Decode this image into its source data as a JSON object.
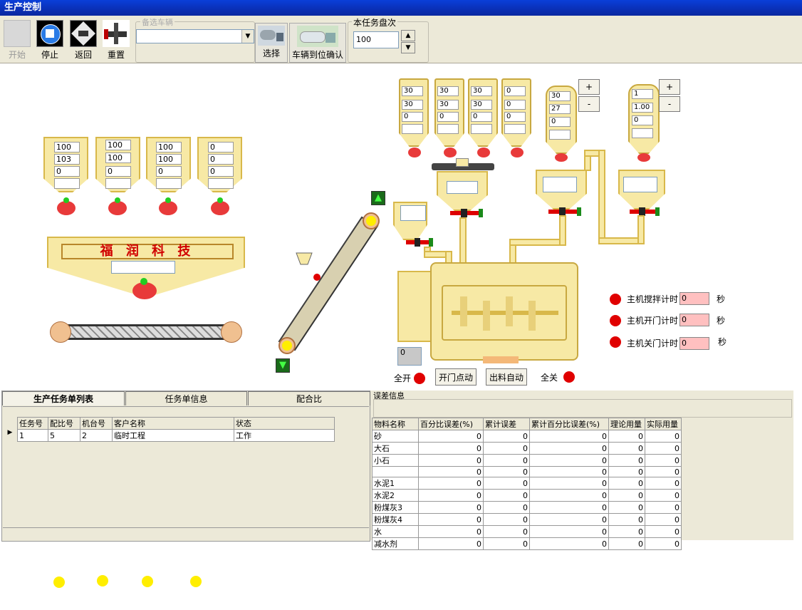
{
  "window": {
    "title": "生产控制"
  },
  "toolbar": {
    "start_label": "开始",
    "stop_label": "停止",
    "back_label": "返回",
    "reset_label": "重置",
    "vehicle_group_label": "备选车辆",
    "vehicle_value": "",
    "select_label": "选择",
    "confirm_label": "车辆到位确认",
    "batches_group_label": "本任务盘次",
    "batches_value": "100"
  },
  "aggregate_bins": [
    {
      "values": [
        "100",
        "103",
        "0",
        ""
      ]
    },
    {
      "values": [
        "100",
        "100",
        "0",
        ""
      ]
    },
    {
      "values": [
        "100",
        "100",
        "0",
        ""
      ]
    },
    {
      "values": [
        "0",
        "0",
        "0",
        ""
      ]
    }
  ],
  "brand_text": "福 润 科 技",
  "weigh_hopper_value": "",
  "powder_silos": [
    {
      "values": [
        "30",
        "30",
        "0",
        ""
      ]
    },
    {
      "values": [
        "30",
        "30",
        "0",
        ""
      ]
    },
    {
      "values": [
        "30",
        "30",
        "0",
        ""
      ]
    },
    {
      "values": [
        "0",
        "0",
        "0",
        ""
      ]
    }
  ],
  "water_tank": {
    "values": [
      "30",
      "27",
      "0",
      ""
    ]
  },
  "additive_tank": {
    "values": [
      "1",
      "1.00",
      "0",
      ""
    ]
  },
  "plus_label": "+",
  "minus_label": "-",
  "timers": [
    {
      "label": "主机搅拌计时",
      "value": "0",
      "unit": "秒"
    },
    {
      "label": "主机开门计时",
      "value": "0",
      "unit": "秒"
    },
    {
      "label": "主机关门计时",
      "value": "0",
      "unit": "秒"
    }
  ],
  "mixer": {
    "counter_value": "0"
  },
  "door_controls": {
    "all_open": "全开",
    "door_jog": "开门点动",
    "discharge_auto": "出料自动",
    "all_close": "全关"
  },
  "tabs": [
    "生产任务单列表",
    "任务单信息",
    "配合比"
  ],
  "task_table": {
    "columns": [
      "任务号",
      "配比号",
      "机台号",
      "客户名称",
      "状态"
    ],
    "rows": [
      [
        "1",
        "5",
        "2",
        "临时工程",
        "工作"
      ]
    ]
  },
  "error_panel": {
    "title": "误差信息",
    "columns": [
      "物料名称",
      "百分比误差(%)",
      "累计误差",
      "累计百分比误差(%)",
      "理论用量",
      "实际用量"
    ],
    "rows": [
      [
        "砂",
        "0",
        "0",
        "0",
        "0",
        "0"
      ],
      [
        "大石",
        "0",
        "0",
        "0",
        "0",
        "0"
      ],
      [
        "小石",
        "0",
        "0",
        "0",
        "0",
        "0"
      ],
      [
        "",
        "0",
        "0",
        "0",
        "0",
        "0"
      ],
      [
        "水泥1",
        "0",
        "0",
        "0",
        "0",
        "0"
      ],
      [
        "水泥2",
        "0",
        "0",
        "0",
        "0",
        "0"
      ],
      [
        "粉煤灰3",
        "0",
        "0",
        "0",
        "0",
        "0"
      ],
      [
        "粉煤灰4",
        "0",
        "0",
        "0",
        "0",
        "0"
      ],
      [
        "水",
        "0",
        "0",
        "0",
        "0",
        "0"
      ],
      [
        "减水剂",
        "0",
        "0",
        "0",
        "0",
        "0"
      ]
    ]
  },
  "colors": {
    "titlebar": "#0a3fd9",
    "hopper_fill": "#f7e9a5",
    "hopper_border": "#d8b84a",
    "indicator_red": "#e00000",
    "indicator_yellow": "#ffee00",
    "timer_box": "#ffc0c0"
  }
}
